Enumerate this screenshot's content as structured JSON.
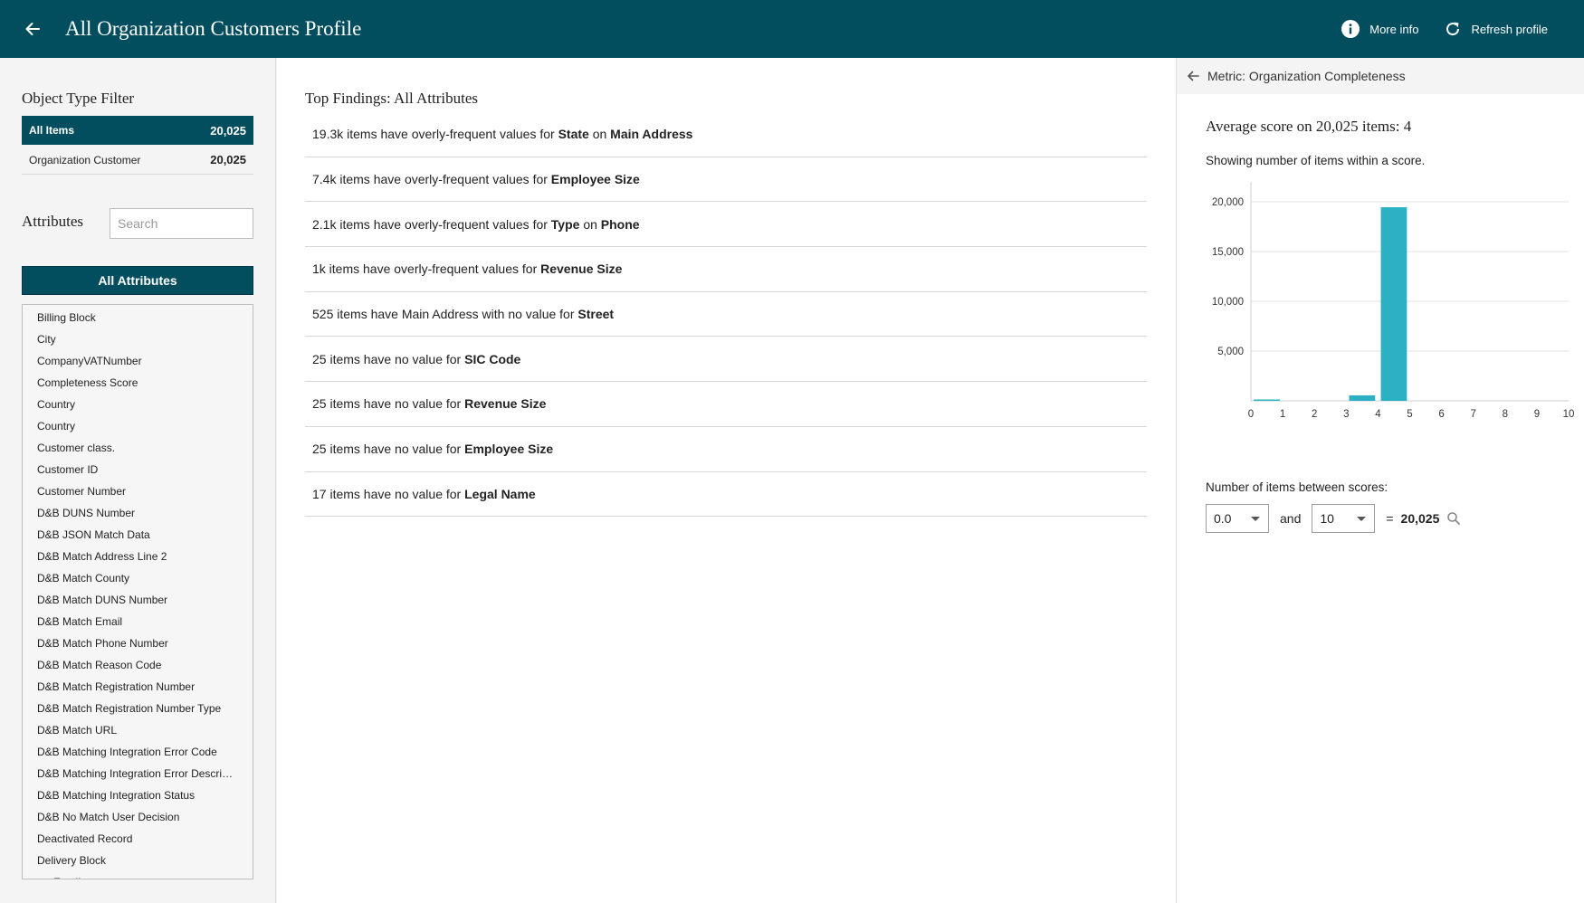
{
  "header": {
    "title": "All Organization Customers Profile",
    "more_info_label": "More info",
    "refresh_label": "Refresh profile"
  },
  "object_type_filter": {
    "title": "Object Type Filter",
    "items": [
      {
        "label": "All Items",
        "count": "20,025"
      },
      {
        "label": "Organization Customer",
        "count": "20,025"
      }
    ]
  },
  "attributes": {
    "title": "Attributes",
    "search_placeholder": "Search",
    "all_label": "All Attributes",
    "items": [
      "Billing Block",
      "City",
      "CompanyVATNumber",
      "Completeness Score",
      "Country",
      "Country",
      "Customer class.",
      "Customer ID",
      "Customer Number",
      "D&B DUNS Number",
      "D&B JSON Match Data",
      "D&B Match Address Line 2",
      "D&B Match County",
      "D&B Match DUNS Number",
      "D&B Match Email",
      "D&B Match Phone Number",
      "D&B Match Reason Code",
      "D&B Match Registration Number",
      "D&B Match Registration Number Type",
      "D&B Match URL",
      "D&B Matching Integration Error Code",
      "D&B Matching Integration Error Description",
      "D&B Matching Integration Status",
      "D&B No Match User Decision",
      "Deactivated Record",
      "Delivery Block",
      "Email"
    ]
  },
  "findings": {
    "title": "Top Findings: All Attributes",
    "items": [
      {
        "pre": "19.3k items have overly-frequent values for ",
        "b1": "State",
        "mid": " on ",
        "b2": "Main Address"
      },
      {
        "pre": "7.4k items have overly-frequent values for ",
        "b1": "Employee Size",
        "mid": "",
        "b2": ""
      },
      {
        "pre": "2.1k items have overly-frequent values for ",
        "b1": "Type",
        "mid": " on ",
        "b2": "Phone"
      },
      {
        "pre": "1k items have overly-frequent values for ",
        "b1": "Revenue Size",
        "mid": "",
        "b2": ""
      },
      {
        "pre": "525 items have Main Address with no value for ",
        "b1": "Street",
        "mid": "",
        "b2": ""
      },
      {
        "pre": "25 items have no value for ",
        "b1": "SIC Code",
        "mid": "",
        "b2": ""
      },
      {
        "pre": "25 items have no value for ",
        "b1": "Revenue Size",
        "mid": "",
        "b2": ""
      },
      {
        "pre": "25 items have no value for ",
        "b1": "Employee Size",
        "mid": "",
        "b2": ""
      },
      {
        "pre": "17 items have no value for ",
        "b1": "Legal Name",
        "mid": "",
        "b2": ""
      }
    ]
  },
  "metric": {
    "title": "Metric: Organization Completeness",
    "average": "Average score on 20,025 items: 4",
    "showing": "Showing number of items within a score.",
    "between_label": "Number of items between scores:",
    "from_value": "0.0",
    "and_label": "and",
    "to_value": "10",
    "equals": "=",
    "total": "20,025"
  },
  "colors": {
    "header": "#024e5e",
    "bar": "#2bb0c4"
  },
  "chart_data": {
    "type": "bar",
    "title": "",
    "xlabel": "",
    "ylabel": "",
    "categories": [
      "0",
      "1",
      "2",
      "3",
      "4",
      "5",
      "6",
      "7",
      "8",
      "9"
    ],
    "values": [
      40,
      0,
      0,
      550,
      19450,
      0,
      0,
      0,
      0,
      0
    ],
    "x_ticks": [
      "0",
      "1",
      "2",
      "3",
      "4",
      "5",
      "6",
      "7",
      "8",
      "9",
      "10"
    ],
    "y_ticks": [
      5000,
      10000,
      15000,
      20000
    ],
    "y_tick_labels": [
      "5,000",
      "10,000",
      "15,000",
      "20,000"
    ],
    "ylim": [
      0,
      22000
    ],
    "grid": true,
    "legend": "none"
  }
}
